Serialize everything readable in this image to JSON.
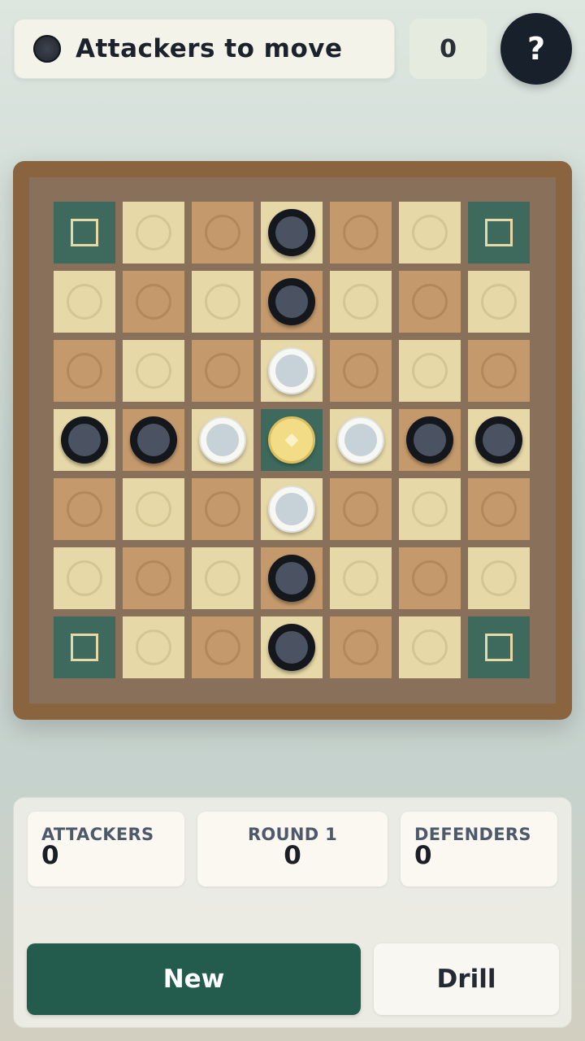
{
  "header": {
    "turn_text": "Attackers to move",
    "turn_side": "attacker",
    "move_count": "0",
    "help_label": "?"
  },
  "board": {
    "size": 7,
    "rows": [
      [
        "corner",
        "empty",
        "empty",
        "attacker",
        "empty",
        "empty",
        "corner"
      ],
      [
        "empty",
        "empty",
        "empty",
        "attacker",
        "empty",
        "empty",
        "empty"
      ],
      [
        "empty",
        "empty",
        "empty",
        "defender",
        "empty",
        "empty",
        "empty"
      ],
      [
        "attacker",
        "attacker",
        "defender",
        "king",
        "defender",
        "attacker",
        "attacker"
      ],
      [
        "empty",
        "empty",
        "empty",
        "defender",
        "empty",
        "empty",
        "empty"
      ],
      [
        "empty",
        "empty",
        "empty",
        "attacker",
        "empty",
        "empty",
        "empty"
      ],
      [
        "corner",
        "empty",
        "empty",
        "attacker",
        "empty",
        "empty",
        "corner"
      ]
    ]
  },
  "stats": {
    "attackers": {
      "label": "ATTACKERS",
      "value": "0"
    },
    "round": {
      "label": "ROUND 1",
      "value": "0"
    },
    "defenders": {
      "label": "DEFENDERS",
      "value": "0"
    }
  },
  "buttons": {
    "new_label": "New",
    "drill_label": "Drill"
  },
  "colors": {
    "frame": "#8a643f",
    "dark_square": "#c49a6c",
    "light_square": "#e7d8a8",
    "special_square": "#3d6a5c",
    "primary_button": "#235b4c",
    "help_button": "#17202b"
  }
}
